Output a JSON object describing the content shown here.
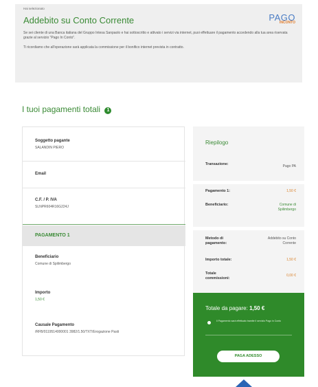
{
  "header": {
    "small_label": "Hai selezionato",
    "title": "Addebito su Conto Corrente",
    "description": "Se sei cliente di una Banca italiana del Gruppo Intesa Sanpaolo e hai sottoscritto e attivato i servizi via internet, puoi effettuare il pagamento accedendo alla tua area riservata grazie al servizio \"Pago In Conto\".",
    "note": "Ti ricordiamo che all'operazione sarà applicata la commissione per il bonifico internet prevista in contratto.",
    "logo_top": "PAGO",
    "logo_bottom": "INCONTO"
  },
  "section": {
    "title": "I tuoi pagamenti totali",
    "badge": "1"
  },
  "payer": {
    "subject_label": "Soggetto pagante",
    "subject_value": "SALANDIN PIERO",
    "email_label": "Email",
    "cf_label": "C.F. / P. IVA",
    "cf_value": "SLNPR604R16G224J"
  },
  "payment1": {
    "header": "PAGAMENTO 1",
    "beneficiary_label": "Beneficiario",
    "beneficiary_value": "Comune di Spilimbergo",
    "amount_label": "Importo",
    "amount_value": "1,50 €",
    "reason_label": "Causale Pagamento",
    "reason_value": "/RFB/0119514000001 3982/1.50/TXT/Erogazione Pasti"
  },
  "summary": {
    "title": "Riepilogo",
    "transaction_label": "Transazione:",
    "transaction_value": "Pago PA",
    "payment1_label": "Pagamento 1:",
    "payment1_value": "1,50 €",
    "beneficiary_label": "Beneficiario:",
    "beneficiary_value": "Comune di Spilimbergo",
    "method_label": "Metodo di pagamento:",
    "method_value": "Addebito su Conto Corrente",
    "total_amount_label": "Importo totale:",
    "total_amount_value": "1,50 €",
    "total_fees_label": "Totale commissioni:",
    "total_fees_value": "0,00 €"
  },
  "total": {
    "label": "Totale da pagare:",
    "value": "1,50 €",
    "radio_text": "Il Pagamento sarà effettuato tramite il servizio Pago in Conto",
    "pay_button": "PAGA ADESSO"
  },
  "colors": {
    "brand_green": "#3a8a35",
    "total_green": "#2f8a2a",
    "accent_orange": "#d9822b",
    "logo_blue": "#4a7cc4"
  },
  "icons": {
    "info": "info-circle-icon",
    "radio": "radio-dot-icon",
    "scroll_top": "arrow-up-icon"
  }
}
